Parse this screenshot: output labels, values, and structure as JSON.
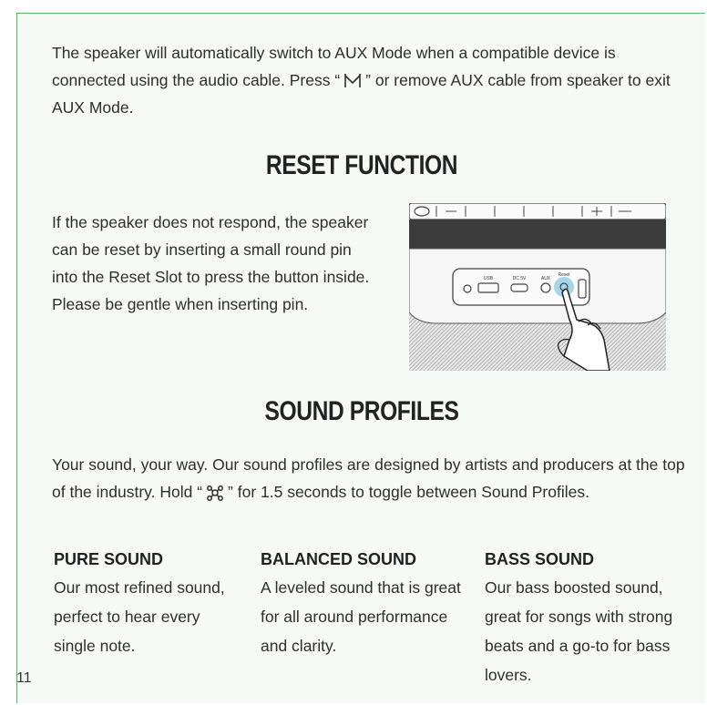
{
  "aux": {
    "text_before": "The speaker will automatically switch to AUX Mode when a compatible device is connected using the audio cable. Press “",
    "icon": "mode-m-icon",
    "text_after": "” or remove AUX cable from speaker to exit AUX Mode."
  },
  "reset": {
    "title": "RESET FUNCTION",
    "body": "If the speaker does not respond, the speaker can be reset by inserting a small round pin into the Reset Slot to press the button inside. Please be gentle when inserting pin.",
    "illustration": {
      "port_labels": [
        "USB",
        "DC 5V",
        "AUX",
        "Reset"
      ]
    }
  },
  "profiles": {
    "title": "SOUND PROFILES",
    "text_before": "Your sound, your way. Our sound profiles are designed by artists and producers at the top of the industry. Hold “",
    "icon": "sound-profile-icon",
    "text_after": "” for 1.5 seconds to toggle between Sound Profiles.",
    "items": [
      {
        "name": "PURE SOUND",
        "desc": "Our most refined sound, perfect to hear every single note."
      },
      {
        "name": "BALANCED SOUND",
        "desc": "A leveled sound that is great for all around performance and clarity."
      },
      {
        "name": "BASS SOUND",
        "desc": "Our bass boosted sound, great for songs with strong beats and a go-to for bass lovers."
      }
    ]
  },
  "page_number": "11",
  "colors": {
    "border": "#54b86a",
    "background": "#f5faf7",
    "highlight": "#7fc6e0"
  }
}
